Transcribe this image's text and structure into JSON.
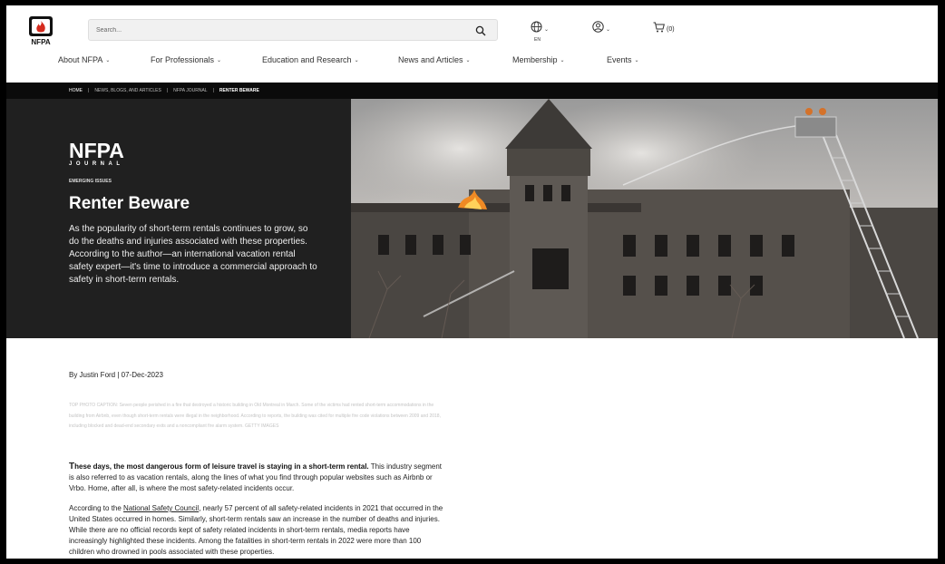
{
  "header": {
    "logo_text": "NFPA",
    "search_placeholder": "Search...",
    "language_code": "EN",
    "cart_count": "(0)",
    "icons": [
      "search-icon",
      "globe-icon",
      "user-icon",
      "cart-icon"
    ]
  },
  "nav": [
    {
      "label": "About NFPA"
    },
    {
      "label": "For Professionals"
    },
    {
      "label": "Education and Research"
    },
    {
      "label": "News and Articles"
    },
    {
      "label": "Membership"
    },
    {
      "label": "Events"
    }
  ],
  "breadcrumb": [
    "HOME",
    "NEWS, BLOGS, AND ARTICLES",
    "NFPA JOURNAL",
    "RENTER BEWARE"
  ],
  "hero": {
    "journal_logo_top": "NFPA",
    "journal_logo_bottom": "JOURNAL",
    "kicker": "EMERGING ISSUES",
    "title": "Renter Beware",
    "deck": "As the popularity of short-term rentals continues to grow, so do the deaths and injuries associated with these properties. According to the author—an international vacation rental safety expert—it's time to introduce a commercial approach to safety in short-term rentals."
  },
  "article": {
    "byline": "By Justin Ford  |  07-Dec-2023",
    "caption": "TOP PHOTO CAPTION: Seven people perished in a fire that destroyed a historic building in Old Montreal in March. Some of the victims had rented short-term accommodations in the building from Airbnb, even though short-term rentals were illegal in the neighborhood. According to reports, the building was cited for multiple fire code violations between 2009 and 2018, including blocked and dead-end secondary exits and a noncompliant fire alarm system. GETTY IMAGES",
    "p1_dropcap": "T",
    "p1_bold": "hese days, the most dangerous form of leisure travel is staying in a short-term rental.",
    "p1_rest": " This industry segment is also referred to as vacation rentals, along the lines of what you find through popular websites such as Airbnb or Vrbo. Home, after all, is where the most safety-related incidents occur.",
    "p2_before": "According to the ",
    "p2_link": "National Safety Council",
    "p2_after": ", nearly 57 percent of all safety-related incidents in 2021 that occurred in the United States occurred in homes. Similarly, short-term rentals saw an increase in the number of deaths and injuries. While there are no official records kept of safety related incidents in short-term rentals, media reports have increasingly highlighted these  incidents. Among the fatalities in short-term rentals in 2022 were more than 100 children who drowned in pools associated with these properties."
  },
  "colors": {
    "brand_red": "#d52b1e",
    "hero_panel": "#202020",
    "breadcrumb_bar": "#0b0b0b"
  }
}
